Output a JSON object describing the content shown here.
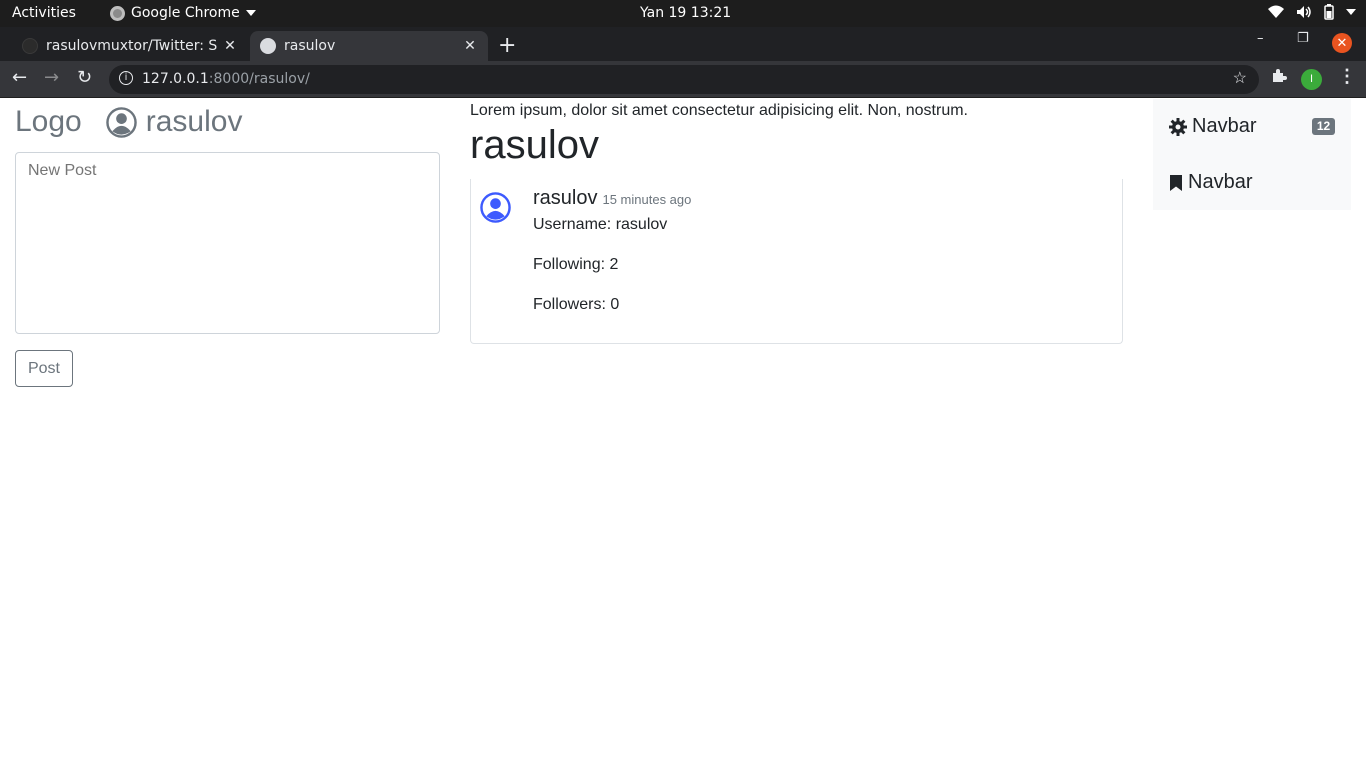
{
  "os_bar": {
    "activities": "Activities",
    "app_name": "Google Chrome",
    "clock": "Yan 19  13:21"
  },
  "browser": {
    "tabs": [
      {
        "title": "rasulovmuxtor/Twitter: S",
        "active": false
      },
      {
        "title": "rasulov",
        "active": true
      }
    ],
    "url_host": "127.0.0.1",
    "url_rest": ":8000/rasulov/",
    "profile_initial": "I"
  },
  "left": {
    "logo": "Logo",
    "username": "rasulov",
    "new_post_placeholder": "New Post",
    "post_button": "Post"
  },
  "main": {
    "lorem": "Lorem ipsum, dolor sit amet consectetur adipisicing elit. Non, nostrum.",
    "title": "rasulov",
    "card": {
      "name": "rasulov",
      "time": "15 minutes ago",
      "username_line": "Username: rasulov",
      "following_line": "Following: 2",
      "followers_line": "Followers: 0"
    }
  },
  "sidenav": {
    "items": [
      {
        "label": "Navbar",
        "icon": "gear-icon",
        "badge": "12"
      },
      {
        "label": "Navbar",
        "icon": "bookmark-icon"
      }
    ]
  },
  "colors": {
    "avatar_blue": "#3d5afe",
    "muted": "#6c757d",
    "close_orange": "#e95420"
  }
}
